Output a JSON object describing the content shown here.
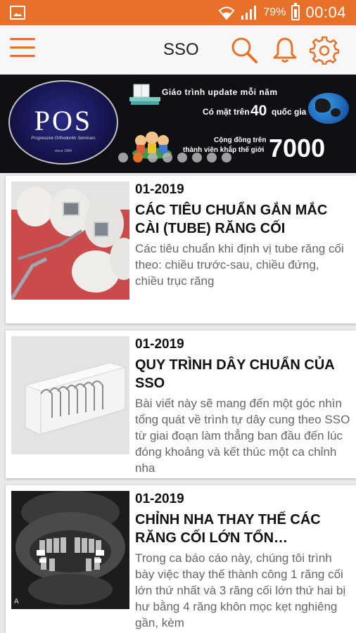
{
  "status_bar": {
    "battery_pct": "79%",
    "time": "00:04"
  },
  "app_bar": {
    "title": "SSO"
  },
  "banner": {
    "logo_text": "POS",
    "logo_subtitle": "Progressive Orthodontic Seminars",
    "logo_since": "since 1984",
    "line1": "Giáo trình update mỗi năm",
    "line2_prefix": "Có mặt trên",
    "line2_number": "40",
    "line2_suffix": "quốc gia",
    "line3": "Cộng đồng trên",
    "line4": "thành viên khắp thế giới",
    "big_number": "7000",
    "dots_count": 8,
    "active_dot": 1
  },
  "articles": [
    {
      "date": "01-2019",
      "title": "CÁC TIÊU CHUẨN GẮN MẮC CÀI (TUBE) RĂNG CỐI",
      "description": "Các tiêu chuẩn khi định vị tube răng cối theo: chiều trước-sau, chiều đứng, chiều trục răng",
      "image": "molar-tube-photo"
    },
    {
      "date": "01-2019",
      "title": "QUY TRÌNH DÂY CHUẨN CỦA SSO",
      "description": "Bài viết này sẽ mang đến một góc nhìn tổng quát về trình tự dây cung theo SSO từ giai đoạn làm thẳng ban đầu đến lúc đóng khoảng và kết thúc một ca chỉnh nha",
      "image": "archwire-set-photo"
    },
    {
      "date": "01-2019",
      "title": "CHỈNH NHA THAY THẾ CÁC RĂNG CỐI LỚN TỔN…",
      "description": "Trong ca báo cáo này, chúng tôi trình bày việc thay thế thành công 1 răng cối lớn thứ nhất và 3 răng cối lớn thứ hai bị hư bằng 4 răng khôn mọc kẹt nghiêng gần, kèm",
      "image": "panoramic-xray"
    }
  ],
  "colors": {
    "accent": "#e8712a",
    "title_text": "#111111",
    "desc_text": "#666666"
  }
}
